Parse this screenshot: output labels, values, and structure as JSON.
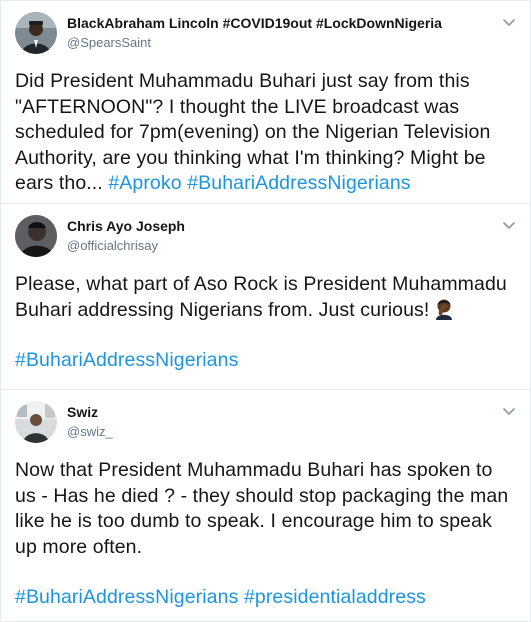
{
  "tweets": [
    {
      "display_name": "BlackAbraham Lincoln #COVID19out #LockDownNigeria",
      "handle": "@SpearsSaint",
      "text": "Did President Muhammadu Buhari just say from this \"AFTERNOON\"? I thought the LIVE broadcast was scheduled for 7pm(evening) on the Nigerian Television Authority, are you thinking what I'm thinking?  Might be ears tho... ",
      "hashtags": [
        "#Aproko",
        "#BuhariAddressNigerians"
      ]
    },
    {
      "display_name": "Chris Ayo Joseph",
      "handle": "@officialchrisay",
      "text": "Please, what part of Aso Rock is President Muhammadu Buhari addressing Nigerians from. Just curious!",
      "emoji": "man-facepalming-emoji",
      "hashtags": [
        "#BuhariAddressNigerians"
      ]
    },
    {
      "display_name": "Swiz",
      "handle": "@swiz_",
      "text": "Now that President Muhammadu Buhari has spoken to us - Has he died ? - they should stop packaging the man like he is too dumb to speak. I encourage him to speak up more often.",
      "hashtags": [
        "#BuhariAddressNigerians",
        "#presidentialaddress"
      ]
    }
  ],
  "icons": {
    "menu": "chevron-down-icon"
  },
  "colors": {
    "link": "#1b95e0",
    "text": "#14171a",
    "secondary": "#657786",
    "divider": "#e6ecf0"
  }
}
